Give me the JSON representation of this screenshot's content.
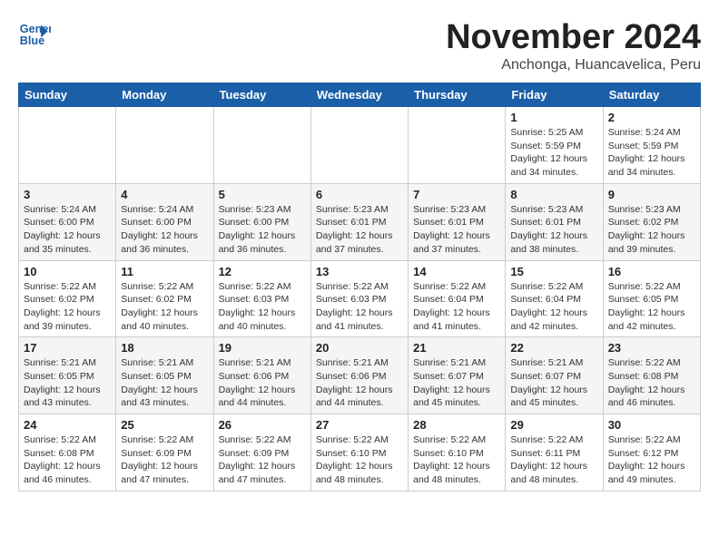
{
  "logo": {
    "line1": "General",
    "line2": "Blue"
  },
  "title": "November 2024",
  "location": "Anchonga, Huancavelica, Peru",
  "weekdays": [
    "Sunday",
    "Monday",
    "Tuesday",
    "Wednesday",
    "Thursday",
    "Friday",
    "Saturday"
  ],
  "weeks": [
    [
      {
        "day": "",
        "info": ""
      },
      {
        "day": "",
        "info": ""
      },
      {
        "day": "",
        "info": ""
      },
      {
        "day": "",
        "info": ""
      },
      {
        "day": "",
        "info": ""
      },
      {
        "day": "1",
        "info": "Sunrise: 5:25 AM\nSunset: 5:59 PM\nDaylight: 12 hours and 34 minutes."
      },
      {
        "day": "2",
        "info": "Sunrise: 5:24 AM\nSunset: 5:59 PM\nDaylight: 12 hours and 34 minutes."
      }
    ],
    [
      {
        "day": "3",
        "info": "Sunrise: 5:24 AM\nSunset: 6:00 PM\nDaylight: 12 hours and 35 minutes."
      },
      {
        "day": "4",
        "info": "Sunrise: 5:24 AM\nSunset: 6:00 PM\nDaylight: 12 hours and 36 minutes."
      },
      {
        "day": "5",
        "info": "Sunrise: 5:23 AM\nSunset: 6:00 PM\nDaylight: 12 hours and 36 minutes."
      },
      {
        "day": "6",
        "info": "Sunrise: 5:23 AM\nSunset: 6:01 PM\nDaylight: 12 hours and 37 minutes."
      },
      {
        "day": "7",
        "info": "Sunrise: 5:23 AM\nSunset: 6:01 PM\nDaylight: 12 hours and 37 minutes."
      },
      {
        "day": "8",
        "info": "Sunrise: 5:23 AM\nSunset: 6:01 PM\nDaylight: 12 hours and 38 minutes."
      },
      {
        "day": "9",
        "info": "Sunrise: 5:23 AM\nSunset: 6:02 PM\nDaylight: 12 hours and 39 minutes."
      }
    ],
    [
      {
        "day": "10",
        "info": "Sunrise: 5:22 AM\nSunset: 6:02 PM\nDaylight: 12 hours and 39 minutes."
      },
      {
        "day": "11",
        "info": "Sunrise: 5:22 AM\nSunset: 6:02 PM\nDaylight: 12 hours and 40 minutes."
      },
      {
        "day": "12",
        "info": "Sunrise: 5:22 AM\nSunset: 6:03 PM\nDaylight: 12 hours and 40 minutes."
      },
      {
        "day": "13",
        "info": "Sunrise: 5:22 AM\nSunset: 6:03 PM\nDaylight: 12 hours and 41 minutes."
      },
      {
        "day": "14",
        "info": "Sunrise: 5:22 AM\nSunset: 6:04 PM\nDaylight: 12 hours and 41 minutes."
      },
      {
        "day": "15",
        "info": "Sunrise: 5:22 AM\nSunset: 6:04 PM\nDaylight: 12 hours and 42 minutes."
      },
      {
        "day": "16",
        "info": "Sunrise: 5:22 AM\nSunset: 6:05 PM\nDaylight: 12 hours and 42 minutes."
      }
    ],
    [
      {
        "day": "17",
        "info": "Sunrise: 5:21 AM\nSunset: 6:05 PM\nDaylight: 12 hours and 43 minutes."
      },
      {
        "day": "18",
        "info": "Sunrise: 5:21 AM\nSunset: 6:05 PM\nDaylight: 12 hours and 43 minutes."
      },
      {
        "day": "19",
        "info": "Sunrise: 5:21 AM\nSunset: 6:06 PM\nDaylight: 12 hours and 44 minutes."
      },
      {
        "day": "20",
        "info": "Sunrise: 5:21 AM\nSunset: 6:06 PM\nDaylight: 12 hours and 44 minutes."
      },
      {
        "day": "21",
        "info": "Sunrise: 5:21 AM\nSunset: 6:07 PM\nDaylight: 12 hours and 45 minutes."
      },
      {
        "day": "22",
        "info": "Sunrise: 5:21 AM\nSunset: 6:07 PM\nDaylight: 12 hours and 45 minutes."
      },
      {
        "day": "23",
        "info": "Sunrise: 5:22 AM\nSunset: 6:08 PM\nDaylight: 12 hours and 46 minutes."
      }
    ],
    [
      {
        "day": "24",
        "info": "Sunrise: 5:22 AM\nSunset: 6:08 PM\nDaylight: 12 hours and 46 minutes."
      },
      {
        "day": "25",
        "info": "Sunrise: 5:22 AM\nSunset: 6:09 PM\nDaylight: 12 hours and 47 minutes."
      },
      {
        "day": "26",
        "info": "Sunrise: 5:22 AM\nSunset: 6:09 PM\nDaylight: 12 hours and 47 minutes."
      },
      {
        "day": "27",
        "info": "Sunrise: 5:22 AM\nSunset: 6:10 PM\nDaylight: 12 hours and 48 minutes."
      },
      {
        "day": "28",
        "info": "Sunrise: 5:22 AM\nSunset: 6:10 PM\nDaylight: 12 hours and 48 minutes."
      },
      {
        "day": "29",
        "info": "Sunrise: 5:22 AM\nSunset: 6:11 PM\nDaylight: 12 hours and 48 minutes."
      },
      {
        "day": "30",
        "info": "Sunrise: 5:22 AM\nSunset: 6:12 PM\nDaylight: 12 hours and 49 minutes."
      }
    ]
  ]
}
